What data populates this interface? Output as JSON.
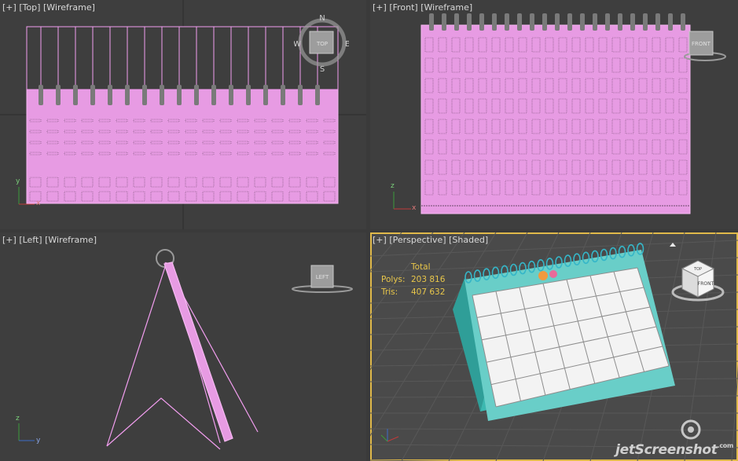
{
  "viewports": {
    "top": {
      "plus": "[+]",
      "view": "[Top]",
      "mode": "[Wireframe]",
      "compass": {
        "n": "N",
        "s": "S",
        "e": "E",
        "w": "W"
      },
      "cube_label": "TOP"
    },
    "front": {
      "plus": "[+]",
      "view": "[Front]",
      "mode": "[Wireframe]",
      "cube_label": "FRONT"
    },
    "left": {
      "plus": "[+]",
      "view": "[Left]",
      "mode": "[Wireframe]",
      "cube_label": "LEFT"
    },
    "perspective": {
      "plus": "[+]",
      "view": "[Perspective]",
      "mode": "[Shaded]",
      "cube_label": "FRONT",
      "cube_top_label": "TOP",
      "stats": {
        "header": "Total",
        "polys_label": "Polys:",
        "polys": "203 816",
        "tris_label": "Tris:",
        "tris": "407 632"
      }
    }
  },
  "axis_labels": {
    "x": "x",
    "y": "y",
    "z": "z"
  },
  "watermark": {
    "text": "jetScreenshot",
    "suffix": ".com"
  },
  "colors": {
    "wire": "#f39ef0",
    "background": "#3e3e3e",
    "active_border": "#e0b94a",
    "calendar_teal": "#5fc6c0"
  }
}
